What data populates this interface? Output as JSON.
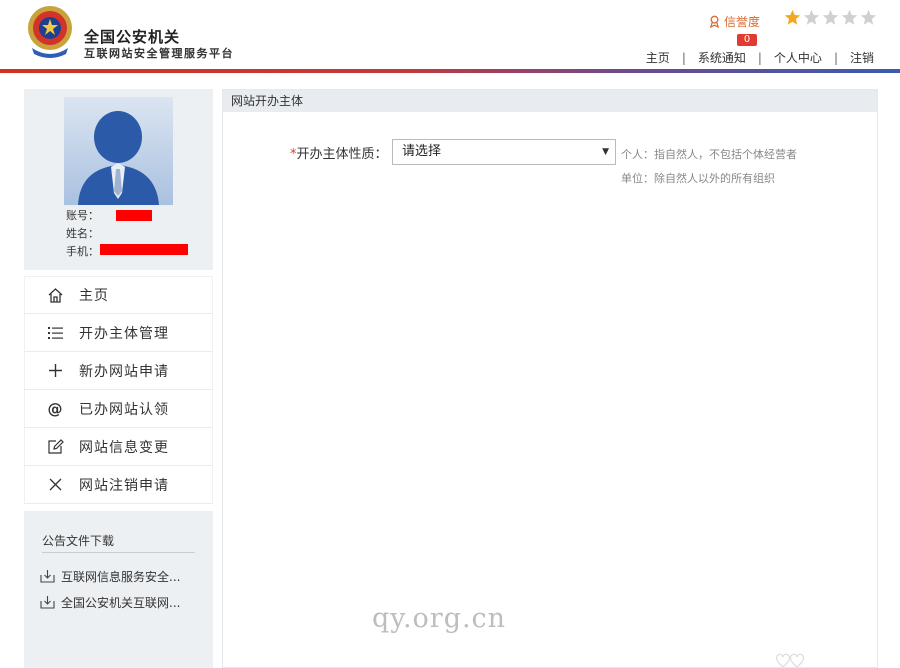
{
  "header": {
    "title": "全国公安机关",
    "subtitle": "互联网站安全管理服务平台",
    "credit_label": "信誉度",
    "notification_count": "0",
    "rating": {
      "filled": 1,
      "max": 5
    },
    "nav": [
      "主页",
      "系统通知",
      "个人中心",
      "注销"
    ]
  },
  "profile": {
    "account_label": "账号：",
    "name_label": "姓名：",
    "phone_label": "手机："
  },
  "sidebar": {
    "items": [
      {
        "label": "主页",
        "icon": "home-icon"
      },
      {
        "label": "开办主体管理",
        "icon": "list-icon"
      },
      {
        "label": "新办网站申请",
        "icon": "plus-icon"
      },
      {
        "label": "已办网站认领",
        "icon": "at-icon"
      },
      {
        "label": "网站信息变更",
        "icon": "edit-icon"
      },
      {
        "label": "网站注销申请",
        "icon": "close-icon"
      }
    ]
  },
  "downloads": {
    "title": "公告文件下载",
    "items": [
      "互联网信息服务安全...",
      "全国公安机关互联网..."
    ]
  },
  "main": {
    "panel_title": "网站开办主体",
    "field_label": "开办主体性质：",
    "required_mark": "*",
    "select_value": "请选择",
    "hint_1": "个人：指自然人，不包括个体经营者",
    "hint_2": "单位：除自然人以外的所有组织"
  },
  "watermark": "qy.org.cn",
  "colors": {
    "accent_red": "#e23a2e",
    "credit_orange": "#d96a2c",
    "star_gold": "#f5a623",
    "panel_header_bg": "#e8ecf0"
  }
}
